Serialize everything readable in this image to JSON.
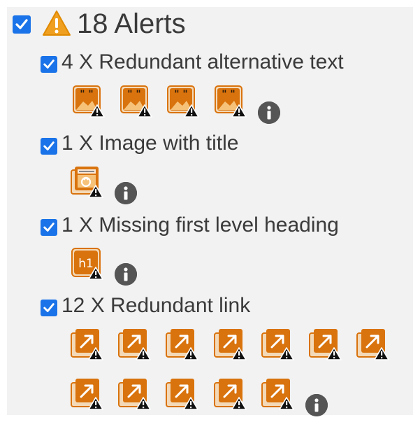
{
  "summary": {
    "count_label": "18 Alerts",
    "icon": "warning-icon",
    "checked": true
  },
  "groups": [
    {
      "label": "4 X Redundant alternative text",
      "icon": "redundant-alt-text-icon",
      "count": 4,
      "checked": true
    },
    {
      "label": "1 X Image with title",
      "icon": "image-with-title-icon",
      "count": 1,
      "checked": true
    },
    {
      "label": "1 X Missing first level heading",
      "icon": "missing-h1-icon",
      "count": 1,
      "checked": true,
      "icon_text": "h1"
    },
    {
      "label": "12 X Redundant link",
      "icon": "redundant-link-icon",
      "count": 12,
      "checked": true
    }
  ],
  "colors": {
    "checkbox": "#1a73e8",
    "warning": "#f0a020",
    "icon_orange": "#d9730d",
    "info": "#555555",
    "panel": "#f2f2f2"
  }
}
